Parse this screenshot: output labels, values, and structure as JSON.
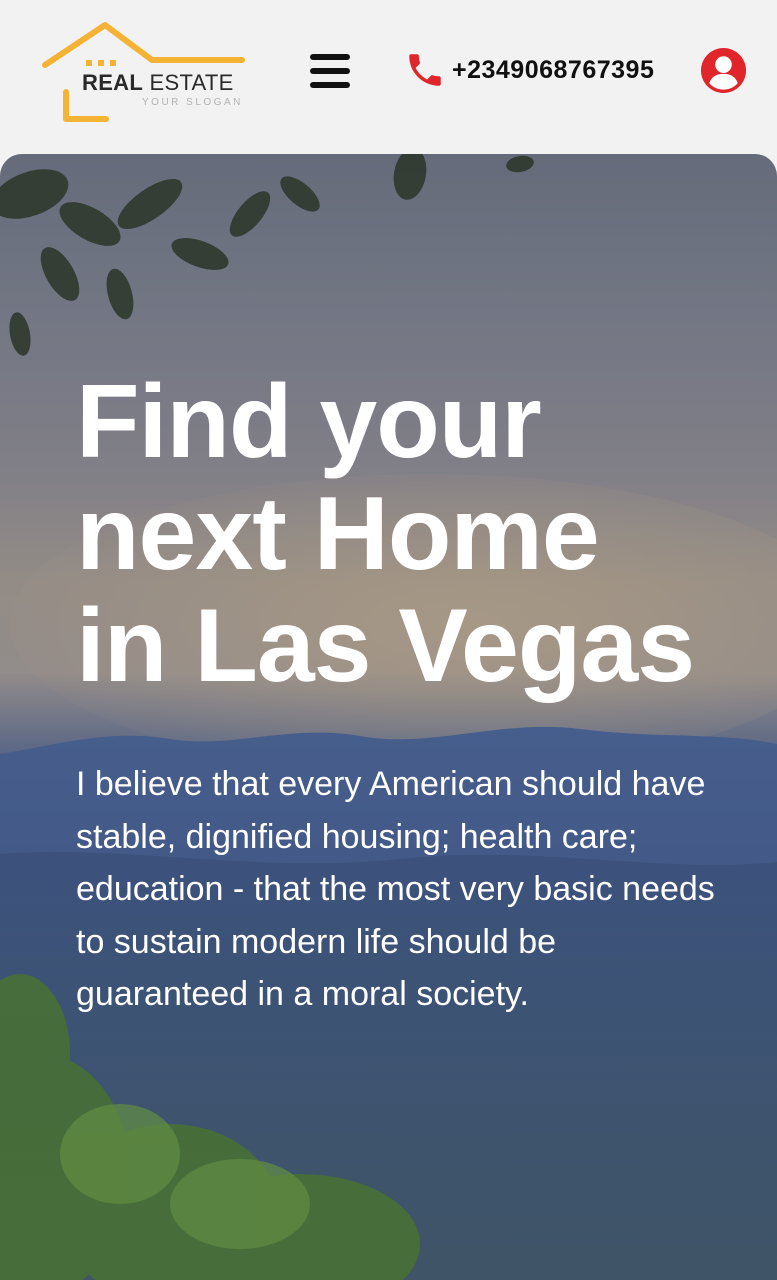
{
  "header": {
    "logo": {
      "name_bold": "REAL",
      "name_light": " ESTATE",
      "slogan": "YOUR SLOGAN",
      "icon": "house-outline-icon",
      "accent_color": "#f5b335"
    },
    "menu_icon": "hamburger-menu-icon",
    "phone": {
      "icon": "phone-icon",
      "number": "+2349068767395",
      "icon_color": "#e0262b"
    },
    "account_icon": "user-circle-icon",
    "account_color": "#e0262b"
  },
  "hero": {
    "title": "Find your\nnext Home\nin Las Vegas",
    "description": "I believe that every American should have stable, dignified housing; health care; education - that the most very basic needs to sustain modern life should be guaranteed in a moral society.",
    "background": "mountain-landscape-photo"
  }
}
